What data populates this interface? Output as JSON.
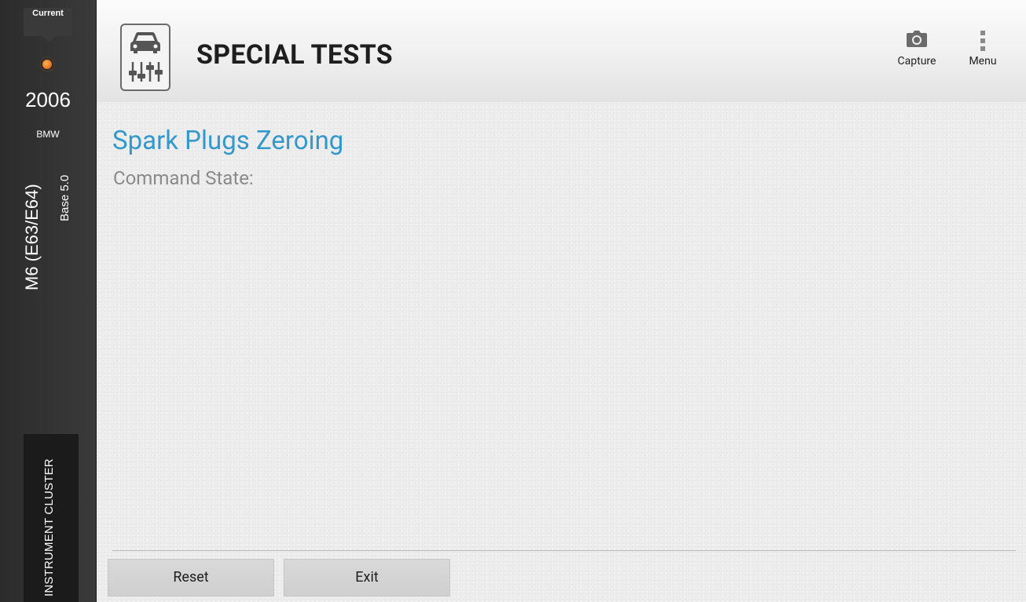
{
  "sidebar": {
    "current_label": "Current",
    "status_color": "#e87a1c",
    "year": "2006",
    "make": "BMW",
    "model": "M6 (E63/E64)",
    "trim": "Base 5.0",
    "module": "INSTRUMENT CLUSTER"
  },
  "header": {
    "title": "SPECIAL TESTS",
    "app_icon": "car-adjustment-icon",
    "actions": {
      "capture": {
        "label": "Capture",
        "icon": "camera-icon"
      },
      "menu": {
        "label": "Menu",
        "icon": "more-vertical-icon"
      }
    }
  },
  "main": {
    "test_title": "Spark Plugs Zeroing",
    "command_state_label": "Command State:",
    "buttons": {
      "reset": "Reset",
      "exit": "Exit"
    }
  },
  "colors": {
    "accent": "#3399cc",
    "sidebar_bg": "#333333",
    "content_bg": "#ededed"
  }
}
